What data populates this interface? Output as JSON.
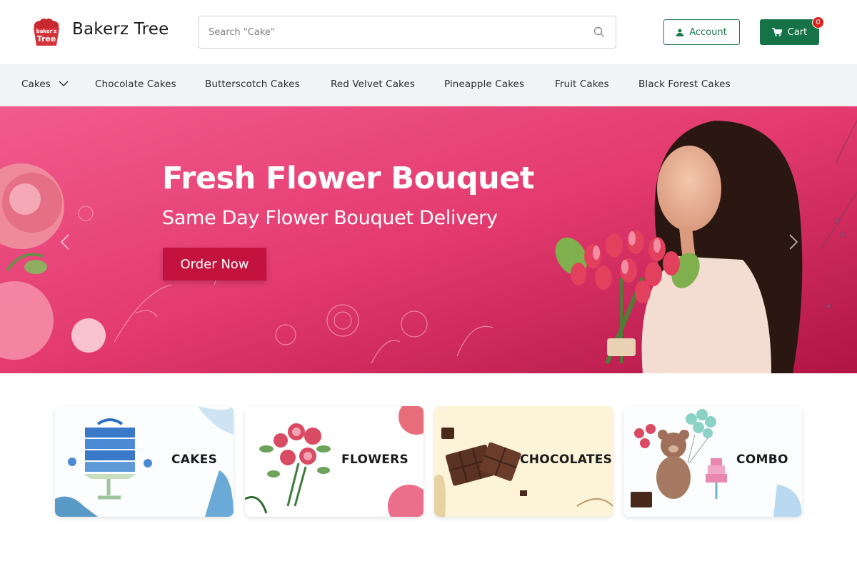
{
  "header": {
    "brand": "Bakerz Tree",
    "logo_text_top": "baker'z",
    "logo_text_bottom": "Tree",
    "search_placeholder": "Search \"Cake\"",
    "account_label": "Account",
    "cart_label": "Cart",
    "cart_count": "0"
  },
  "nav": {
    "items": [
      {
        "label": "Cakes"
      },
      {
        "label": "Chocolate Cakes"
      },
      {
        "label": "Butterscotch Cakes"
      },
      {
        "label": "Red Velvet Cakes"
      },
      {
        "label": "Pineapple Cakes"
      },
      {
        "label": "Fruit Cakes"
      },
      {
        "label": "Black Forest Cakes"
      }
    ]
  },
  "hero": {
    "title": "Fresh Flower Bouquet",
    "subtitle": "Same Day Flower Bouquet Delivery",
    "cta": "Order Now"
  },
  "categories": [
    {
      "label": "CAKES",
      "icon": "cake-illustration"
    },
    {
      "label": "FLOWERS",
      "icon": "flower-bouquet-illustration"
    },
    {
      "label": "CHOCOLATES",
      "icon": "chocolate-illustration"
    },
    {
      "label": "COMBO",
      "icon": "teddy-combo-illustration"
    }
  ],
  "colors": {
    "brand_green": "#157347",
    "hero_pink": "#e8437a",
    "cta_red": "#c4123f",
    "badge_red": "#e0201a"
  }
}
